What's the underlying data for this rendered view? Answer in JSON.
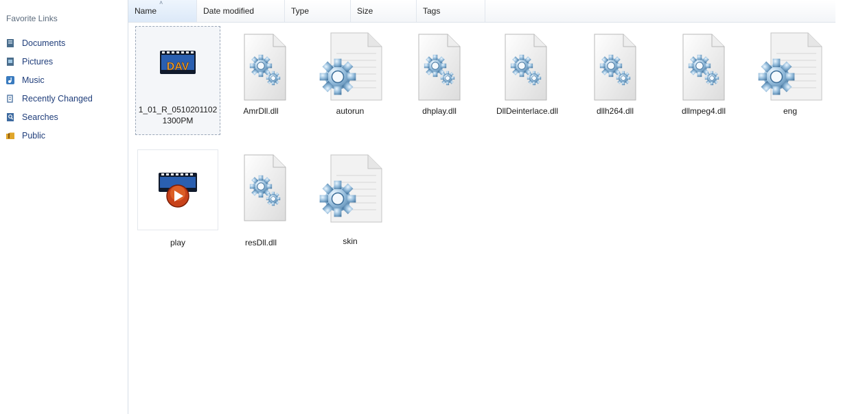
{
  "sidebar": {
    "title": "Favorite Links",
    "items": [
      {
        "label": "Documents",
        "icon": "documents-icon",
        "color": "#4a6d8c"
      },
      {
        "label": "Pictures",
        "icon": "pictures-icon",
        "color": "#4a6d8c"
      },
      {
        "label": "Music",
        "icon": "music-icon",
        "color": "#3a7bbf"
      },
      {
        "label": "Recently Changed",
        "icon": "recently-changed-icon",
        "color": "#5a7fa8"
      },
      {
        "label": "Searches",
        "icon": "searches-icon",
        "color": "#3d6aa0"
      },
      {
        "label": "Public",
        "icon": "public-folder-icon",
        "color": "#e0a52a"
      }
    ]
  },
  "columns": [
    "Name",
    "Date modified",
    "Type",
    "Size",
    "Tags"
  ],
  "files": [
    {
      "name_line1": "1_01_R_0510201102",
      "name_line2": "1300PM",
      "icon": "dav-video-icon",
      "badge": "DAV"
    },
    {
      "name_line1": "AmrDll.dll",
      "icon": "dll-gear-icon"
    },
    {
      "name_line1": "autorun",
      "icon": "config-gear-icon"
    },
    {
      "name_line1": "dhplay.dll",
      "icon": "dll-gear-icon"
    },
    {
      "name_line1": "DllDeinterlace.dll",
      "icon": "dll-gear-icon"
    },
    {
      "name_line1": "dllh264.dll",
      "icon": "dll-gear-icon"
    },
    {
      "name_line1": "dllmpeg4.dll",
      "icon": "dll-gear-icon"
    },
    {
      "name_line1": "eng",
      "icon": "config-gear-icon"
    },
    {
      "name_line1": "play",
      "icon": "player-app-icon"
    },
    {
      "name_line1": "resDll.dll",
      "icon": "dll-gear-icon"
    },
    {
      "name_line1": "skin",
      "icon": "config-gear-icon"
    }
  ]
}
